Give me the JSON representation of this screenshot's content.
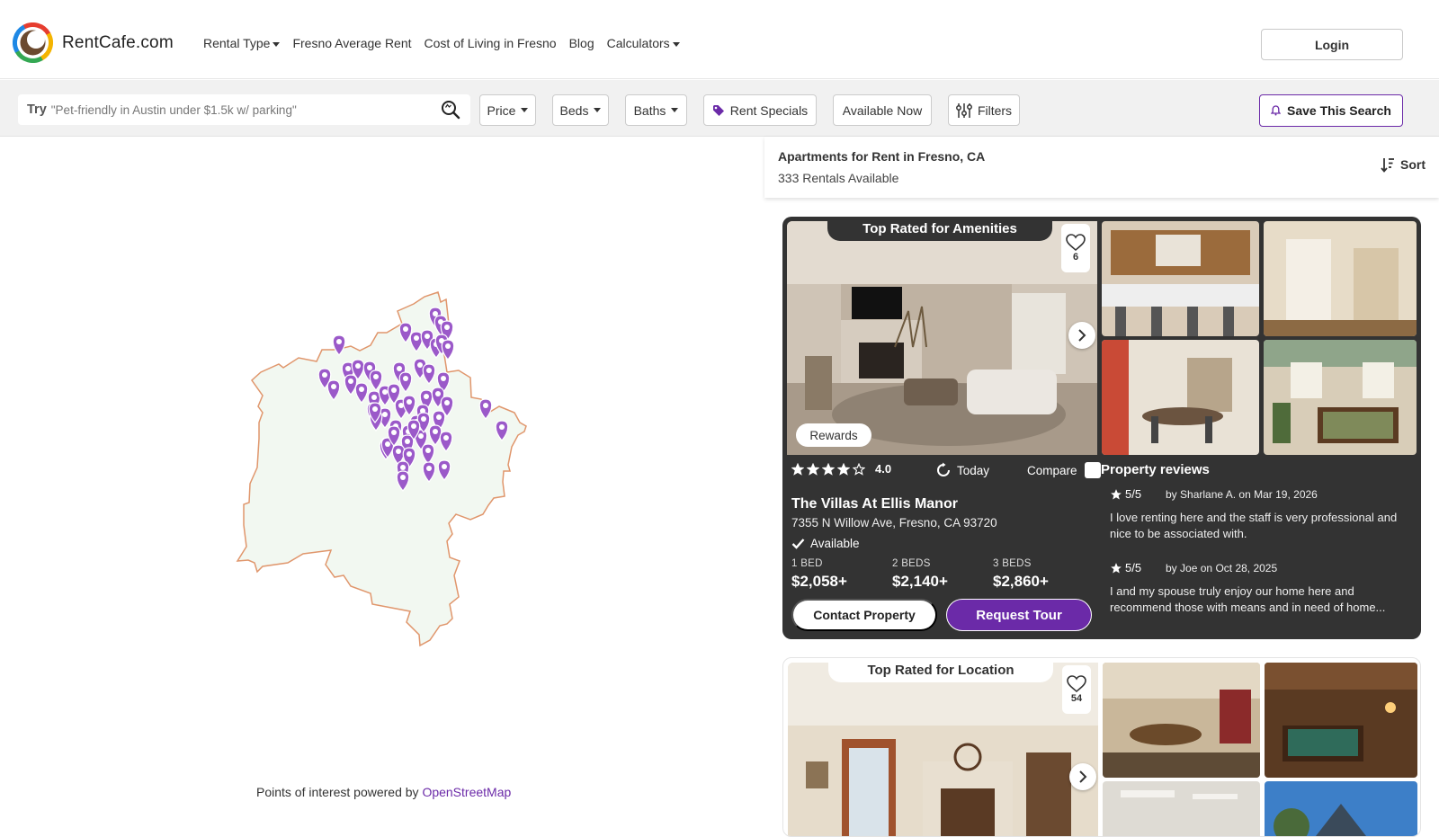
{
  "brand": {
    "name": "RentCafe.com"
  },
  "nav": {
    "items": [
      {
        "label": "Rental Type",
        "dropdown": true
      },
      {
        "label": "Fresno Average Rent",
        "dropdown": false
      },
      {
        "label": "Cost of Living in Fresno",
        "dropdown": false
      },
      {
        "label": "Blog",
        "dropdown": false
      },
      {
        "label": "Calculators",
        "dropdown": true
      }
    ],
    "login_label": "Login"
  },
  "filters": {
    "search_prefix": "Try",
    "search_placeholder": "\"Pet-friendly in Austin under $1.5k w/ parking\"",
    "price_label": "Price",
    "beds_label": "Beds",
    "baths_label": "Baths",
    "specials_label": "Rent Specials",
    "available_label": "Available Now",
    "filters_label": "Filters",
    "save_label": "Save This Search"
  },
  "map": {
    "attribution_prefix": "Points of interest powered by",
    "attribution_link": "OpenStreetMap",
    "pin_color": "#9b59c9",
    "area_fill": "#f2f8f1",
    "area_stroke": "#e0966c"
  },
  "listing": {
    "title": "Apartments for Rent in Fresno, CA",
    "count": "333 Rentals Available",
    "sort_label": "Sort"
  },
  "cards": [
    {
      "ribbon": "Top Rated for Amenities",
      "favorites": "6",
      "rewards": "Rewards",
      "rating": 4.0,
      "rating_text": "4.0",
      "updated": "Today",
      "compare_label": "Compare",
      "name": "The Villas At Ellis Manor",
      "address": "7355 N Willow Ave, Fresno, CA 93720",
      "availability": "Available",
      "prices": [
        {
          "label": "1 BED",
          "value": "$2,058+"
        },
        {
          "label": "2 BEDS",
          "value": "$2,140+"
        },
        {
          "label": "3 BEDS",
          "value": "$2,860+"
        }
      ],
      "contact_label": "Contact Property",
      "tour_label": "Request Tour",
      "reviews_title": "Property reviews",
      "reviews": [
        {
          "score": "5/5",
          "by_prefix": "by",
          "author": "Sharlane A.",
          "on": "on",
          "date": "Mar 19, 2026",
          "text": "I love renting here and the staff is very professional and nice to be associated with."
        },
        {
          "score": "5/5",
          "by_prefix": "by",
          "author": "Joe",
          "on": "on",
          "date": "Oct 28, 2025",
          "text": "I and my spouse truly enjoy our home here and recommend those with means and in need of home..."
        }
      ]
    },
    {
      "ribbon": "Top Rated for Location",
      "favorites": "54"
    }
  ],
  "colors": {
    "accent": "#6b2aa8",
    "card_dark": "#333333"
  }
}
